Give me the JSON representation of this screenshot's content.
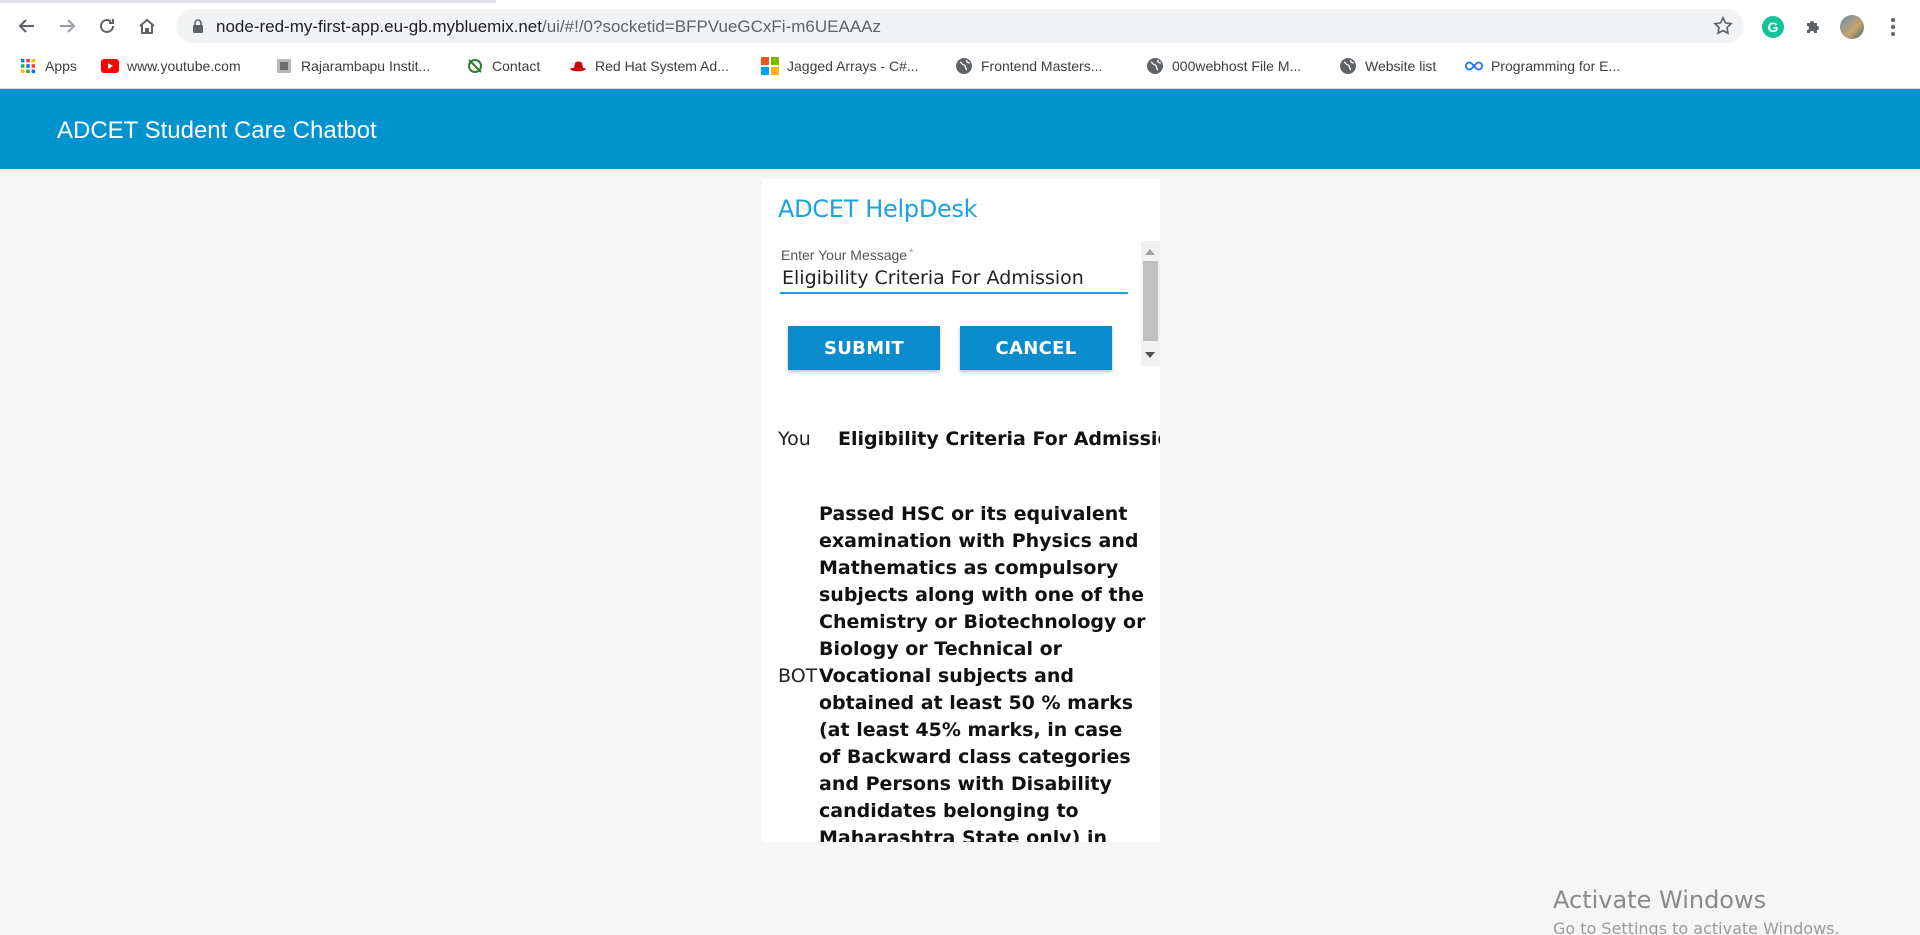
{
  "browser": {
    "url_host": "node-red-my-first-app.eu-gb.mybluemix.net",
    "url_path": "/ui/#!/0?socketid=BFPVueGCxFi-m6UEAAAz",
    "bookmarks": [
      {
        "label": "Apps",
        "icon": "apps-grid-icon"
      },
      {
        "label": "www.youtube.com",
        "icon": "youtube-icon"
      },
      {
        "label": "Rajarambapu Instit...",
        "icon": "institute-icon"
      },
      {
        "label": "Contact",
        "icon": "contact-icon"
      },
      {
        "label": "Red Hat System Ad...",
        "icon": "redhat-icon"
      },
      {
        "label": "Jagged Arrays - C#...",
        "icon": "microsoft-icon"
      },
      {
        "label": "Frontend Masters...",
        "icon": "globe-icon"
      },
      {
        "label": "000webhost File M...",
        "icon": "globe-icon"
      },
      {
        "label": "Website list",
        "icon": "globe-icon"
      },
      {
        "label": "Programming for E...",
        "icon": "infinity-icon"
      }
    ]
  },
  "app": {
    "title": "ADCET Student Care Chatbot"
  },
  "helpdesk": {
    "title": "ADCET HelpDesk",
    "input_label": "Enter Your Message",
    "input_required_mark": "*",
    "input_value": "Eligibility Criteria For Admission",
    "submit_label": "SUBMIT",
    "cancel_label": "CANCEL"
  },
  "chat": {
    "user_label": "You",
    "user_message": "Eligibility Criteria For Admission",
    "bot_label": "BOT",
    "bot_message": "Passed HSC or its equivalent examination with Physics and Mathematics as compulsory subjects along with one of the Chemistry or Biotechnology or Biology or Technical or Vocational subjects and obtained at least 50 % marks (at least 45% marks, in case of Backward class categories and Persons with Disability candidates belonging to Maharashtra State only) in the above subjects taken together."
  },
  "os_overlay": {
    "title": "Activate Windows",
    "subtitle": "Go to Settings to activate Windows."
  }
}
